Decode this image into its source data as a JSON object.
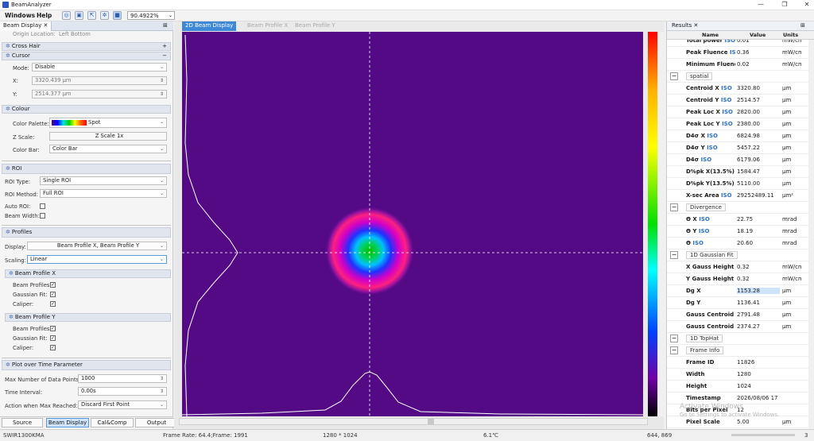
{
  "app": {
    "title": "BeamAnalyzer"
  },
  "menu": {
    "windows": "Windows",
    "help": "Help",
    "zoom": "90.4922%"
  },
  "left": {
    "tab_label": "Beam Display",
    "origin_label": "Origin Location:",
    "origin_value": "Left Bottom",
    "crosshair": "Cross Hair",
    "cursor": {
      "title": "Cursor",
      "mode_label": "Mode:",
      "mode_value": "Disable",
      "x_label": "X:",
      "x_value": "3320.439 µm",
      "y_label": "Y:",
      "y_value": "2514.377 µm"
    },
    "colour": {
      "title": "Colour",
      "palette_label": "Color Palette:",
      "palette_value": "Spot",
      "zscale_label": "Z Scale:",
      "zscale_value": "Z Scale 1x",
      "colorbar_label": "Color Bar:",
      "colorbar_value": "Color Bar"
    },
    "roi": {
      "title": "ROI",
      "type_label": "ROI Type:",
      "type_value": "Single ROI",
      "method_label": "ROI Method:",
      "method_value": "Full ROI",
      "auto_label": "Auto ROI:",
      "width_label": "Beam Width:"
    },
    "profiles": {
      "title": "Profiles",
      "display_label": "Display:",
      "display_value": "Beam Profile X, Beam Profile Y",
      "scaling_label": "Scaling:",
      "scaling_value": "Linear"
    },
    "bpx": {
      "title": "Beam Profile X",
      "profiles_label": "Beam Profiles:",
      "gauss_label": "Gaussian Fit:",
      "caliper_label": "Caliper:"
    },
    "bpy": {
      "title": "Beam Profile Y",
      "profiles_label": "Beam Profiles:",
      "gauss_label": "Gaussian Fit:",
      "caliper_label": "Caliper:"
    },
    "plot": {
      "title": "Plot over Time Parameter",
      "max_label": "Max Number of Data Points:",
      "max_value": "1000",
      "interval_label": "Time Interval:",
      "interval_value": "0.00s",
      "action_label": "Action when Max Reached:",
      "action_value": "Discard First Point"
    },
    "bottom_tabs": [
      "Source",
      "Beam Display",
      "Cal&Comp",
      "Output"
    ]
  },
  "center": {
    "tabs": [
      "2D Beam Display",
      "Beam Profile X",
      "Beam Profile Y"
    ],
    "accent": "#3f88d6",
    "background_color": "#540a85"
  },
  "results": {
    "tab_label": "Results",
    "columns": {
      "name": "Name",
      "value": "Value",
      "units": "Units"
    },
    "rows": [
      {
        "name": "Total power",
        "iso": "ISO",
        "value": "0.01",
        "unit": "mW/cm²"
      },
      {
        "name": "Peak Fluence",
        "iso": "ISO",
        "value": "0.36",
        "unit": "mW/cm²"
      },
      {
        "name": "Minimum Fluence",
        "iso": "",
        "value": "0.02",
        "unit": "mW/cm²"
      },
      {
        "group": "spatial"
      },
      {
        "name": "Centroid X",
        "iso": "ISO",
        "value": "3320.80",
        "unit": "µm"
      },
      {
        "name": "Centroid Y",
        "iso": "ISO",
        "value": "2514.57",
        "unit": "µm"
      },
      {
        "name": "Peak Loc X",
        "iso": "ISO",
        "value": "2820.00",
        "unit": "µm"
      },
      {
        "name": "Peak Loc Y",
        "iso": "ISO",
        "value": "2380.00",
        "unit": "µm"
      },
      {
        "name": "D4σ X",
        "iso": "ISO",
        "value": "6824.98",
        "unit": "µm"
      },
      {
        "name": "D4σ Y",
        "iso": "ISO",
        "value": "5457.22",
        "unit": "µm"
      },
      {
        "name": "D4σ",
        "iso": "ISO",
        "value": "6179.06",
        "unit": "µm"
      },
      {
        "name": "D%pk X(13.5%)",
        "iso": "IS",
        "value": "1584.47",
        "unit": "µm"
      },
      {
        "name": "D%pk Y(13.5%)",
        "iso": "IS",
        "value": "5110.00",
        "unit": "µm"
      },
      {
        "name": "X-sec Area",
        "iso": "ISO",
        "value": "29252489.11",
        "unit": "µm²"
      },
      {
        "group": "Divergence"
      },
      {
        "name": "Θ X",
        "iso": "ISO",
        "value": "22.75",
        "unit": "mrad"
      },
      {
        "name": "Θ Y",
        "iso": "ISO",
        "value": "18.19",
        "unit": "mrad"
      },
      {
        "name": "Θ",
        "iso": "ISO",
        "value": "20.60",
        "unit": "mrad"
      },
      {
        "group": "1D Gaussian Fit"
      },
      {
        "name": "X Gauss Height Z",
        "iso": "",
        "value": "0.32",
        "unit": "mW/cm²"
      },
      {
        "name": "Y Gauss Height Z",
        "iso": "",
        "value": "0.32",
        "unit": "mW/cm²"
      },
      {
        "name": "Dg X",
        "iso": "",
        "value": "1153.28",
        "unit": "µm",
        "selected": true
      },
      {
        "name": "Dg Y",
        "iso": "",
        "value": "1136.41",
        "unit": "µm"
      },
      {
        "name": "Gauss Centroid X",
        "iso": "",
        "value": "2791.48",
        "unit": "µm"
      },
      {
        "name": "Gauss Centroid Y",
        "iso": "",
        "value": "2374.27",
        "unit": "µm"
      },
      {
        "group": "1D TopHat"
      },
      {
        "group": "Frame Info"
      },
      {
        "name": "Frame ID",
        "iso": "",
        "value": "11826",
        "unit": ""
      },
      {
        "name": "Width",
        "iso": "",
        "value": "1280",
        "unit": ""
      },
      {
        "name": "Height",
        "iso": "",
        "value": "1024",
        "unit": ""
      },
      {
        "name": "Timestamp",
        "iso": "",
        "value": "2026/08/06 17",
        "unit": ""
      },
      {
        "name": "Bits per Pixel",
        "iso": "",
        "value": "12",
        "unit": ""
      },
      {
        "name": "Pixel Scale",
        "iso": "",
        "value": "5.00",
        "unit": "µm"
      }
    ]
  },
  "watermark": {
    "line1": "Activate Windows",
    "line2": "Go to Settings to activate Windows."
  },
  "status": {
    "camera": "SWIR1300KMA",
    "frame": "Frame Rate: 64.4;Frame: 1991",
    "resolution": "1280 * 1024",
    "temp": "6.1℃",
    "cursor": "644, 869",
    "zoom_num": "3"
  }
}
